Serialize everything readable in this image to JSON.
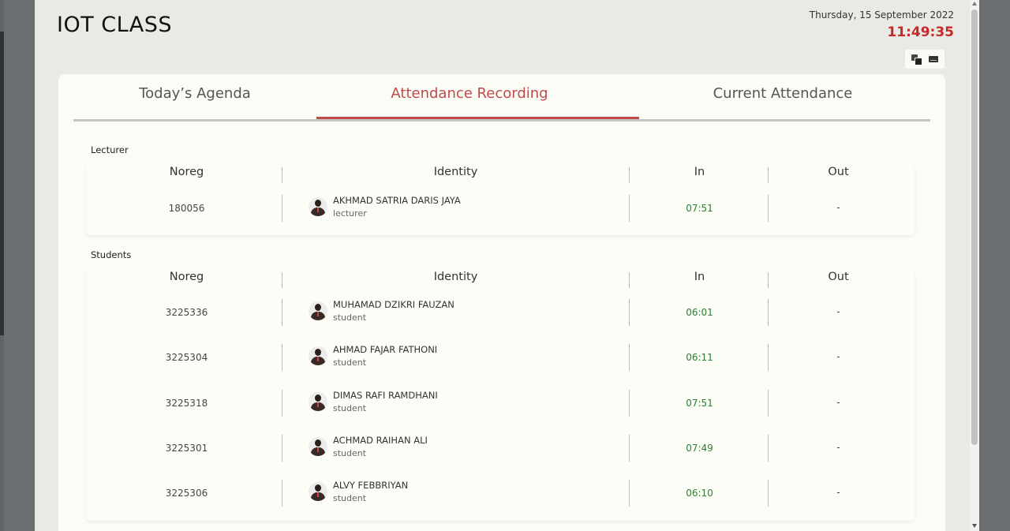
{
  "header": {
    "title": "IOT CLASS",
    "date": "Thursday, 15 September 2022",
    "clock": "11:49:35"
  },
  "tabs": [
    {
      "label": "Today’s Agenda",
      "active": false
    },
    {
      "label": "Attendance Recording",
      "active": true
    },
    {
      "label": "Current Attendance",
      "active": false
    }
  ],
  "columns": {
    "noreg": "Noreg",
    "identity": "Identity",
    "in": "In",
    "out": "Out"
  },
  "lecturer": {
    "section_label": "Lecturer",
    "rows": [
      {
        "noreg": "180056",
        "name": "AKHMAD SATRIA DARIS JAYA",
        "role": "lecturer",
        "in": "07:51",
        "out": "-"
      }
    ]
  },
  "students": {
    "section_label": "Students",
    "rows": [
      {
        "noreg": "3225336",
        "name": "MUHAMAD DZIKRI FAUZAN",
        "role": "student",
        "in": "06:01",
        "out": "-"
      },
      {
        "noreg": "3225304",
        "name": "AHMAD FAJAR FATHONI",
        "role": "student",
        "in": "06:11",
        "out": "-"
      },
      {
        "noreg": "3225318",
        "name": "DIMAS RAFI RAMDHANI",
        "role": "student",
        "in": "07:51",
        "out": "-"
      },
      {
        "noreg": "3225301",
        "name": "ACHMAD RAIHAN ALI",
        "role": "student",
        "in": "07:49",
        "out": "-"
      },
      {
        "noreg": "3225306",
        "name": "ALVY FEBBRIYAN",
        "role": "student",
        "in": "06:10",
        "out": "-"
      }
    ]
  },
  "colors": {
    "accent": "#c04a4a",
    "clock": "#c42a2a",
    "in_time": "#2e7d32"
  },
  "icons": {
    "copy": "copy-icon",
    "keyboard": "keyboard-icon",
    "avatar": "avatar-icon"
  }
}
